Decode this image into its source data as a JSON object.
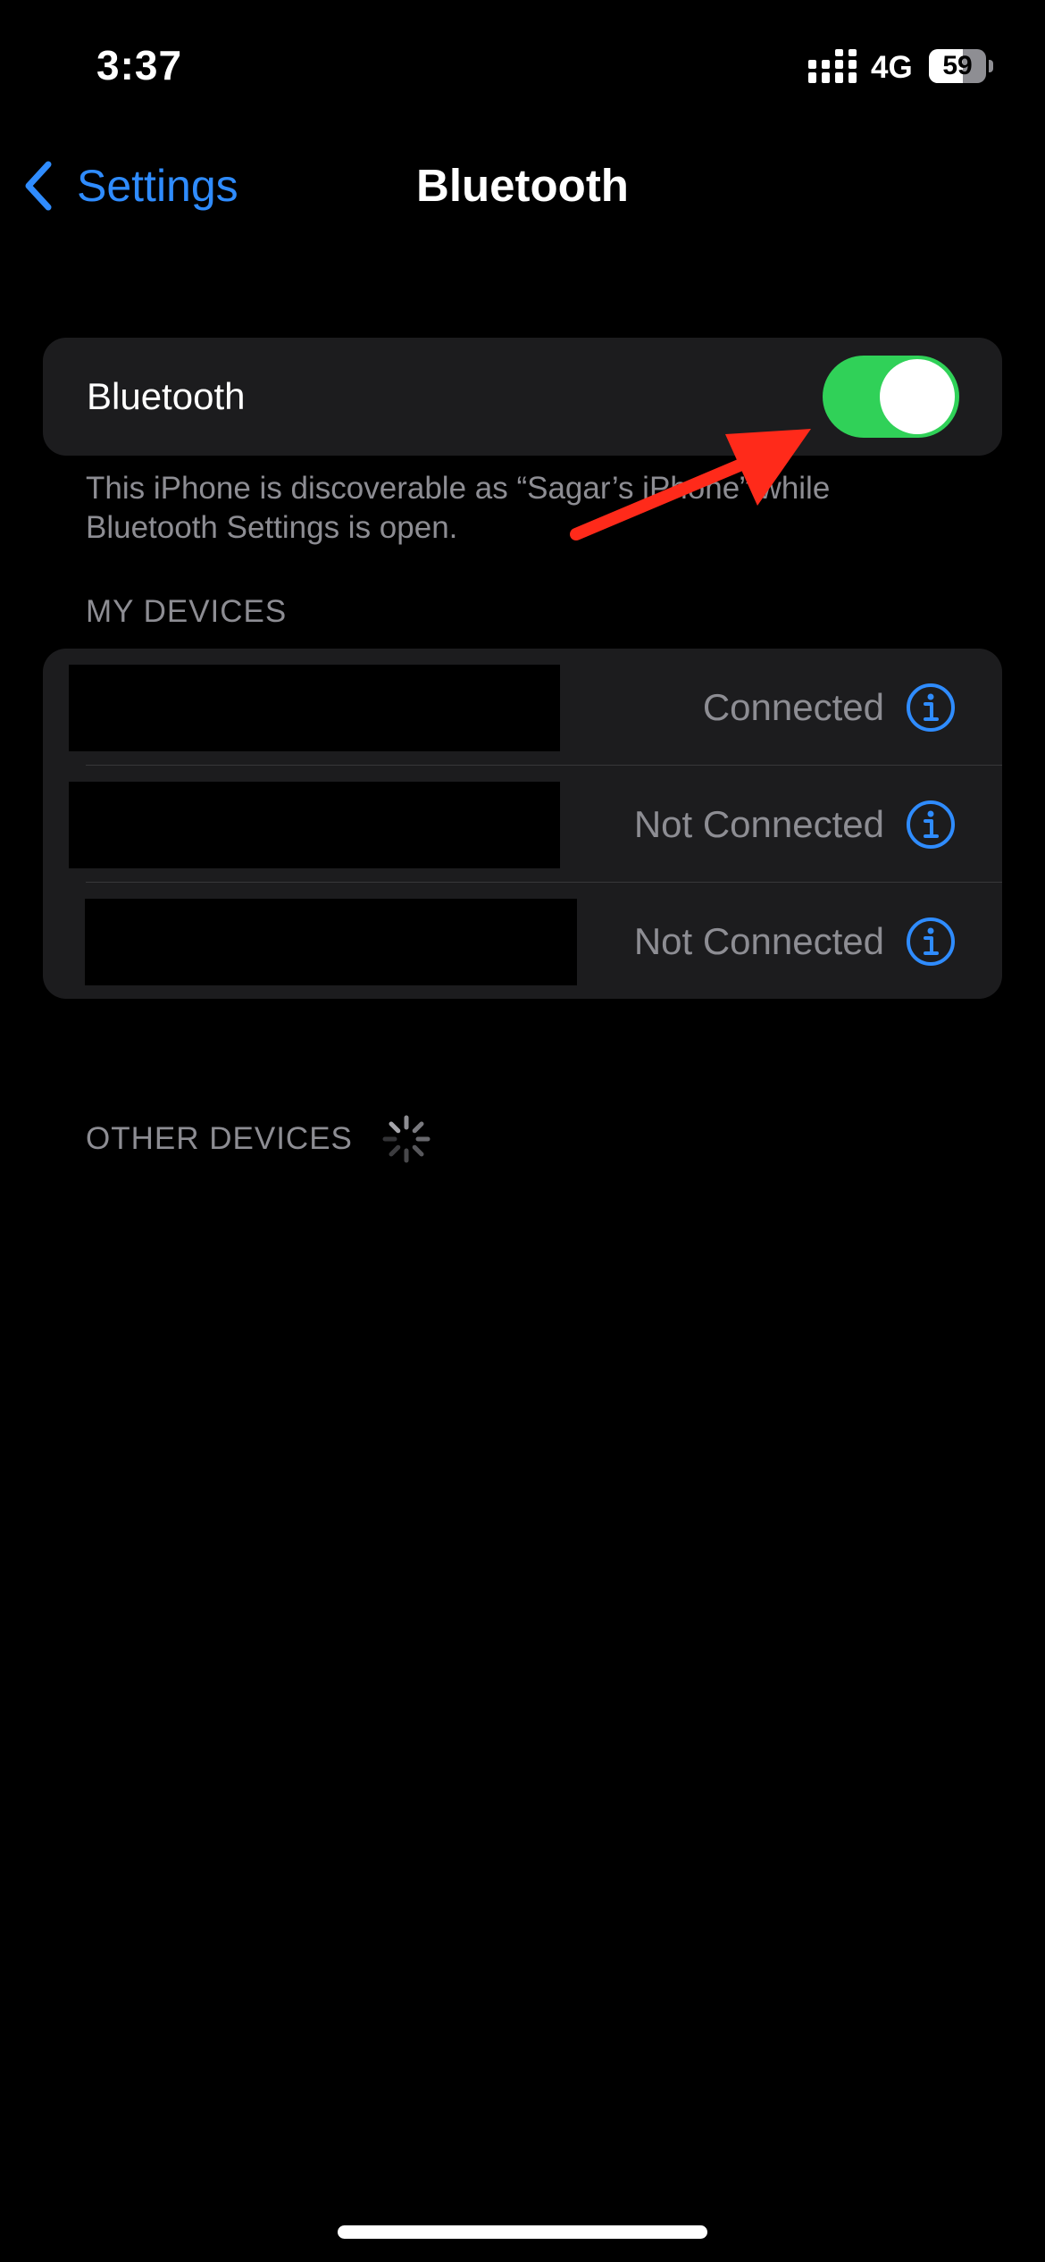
{
  "status_bar": {
    "time": "3:37",
    "network": "4G",
    "battery_level": "59",
    "battery_fraction": 0.59
  },
  "nav": {
    "back_label": "Settings",
    "title": "Bluetooth"
  },
  "bluetooth_toggle": {
    "label": "Bluetooth",
    "state": "on",
    "on_color": "#30d158"
  },
  "footer": {
    "discoverable_text": "This iPhone is discoverable as “Sagar’s iPhone” while Bluetooth Settings is open."
  },
  "my_devices": {
    "header": "MY DEVICES",
    "items": [
      {
        "name": "",
        "status": "Connected"
      },
      {
        "name": "",
        "status": "Not Connected"
      },
      {
        "name": "",
        "status": "Not Connected"
      }
    ]
  },
  "other_devices": {
    "header": "OTHER DEVICES"
  },
  "colors": {
    "accent": "#2f8cff",
    "annotation": "#ff2a1a",
    "group_background": "#1c1c1e",
    "secondary_text": "#8d8d93"
  },
  "icons": {
    "back": "chevron-left-icon",
    "signal": "signal-icon",
    "battery": "battery-icon",
    "info": "info-icon",
    "spinner": "spinner-icon",
    "annotation": "annotation-arrow"
  }
}
